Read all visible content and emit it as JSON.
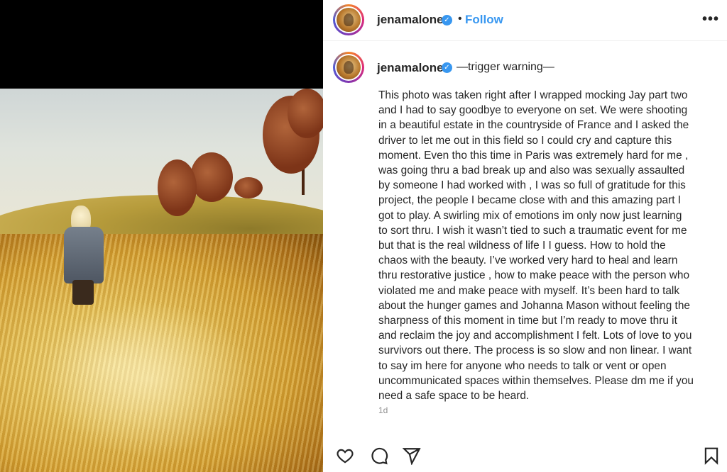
{
  "post": {
    "username": "jenamalone",
    "verified_icon": "verified-badge-icon",
    "separator": "•",
    "follow_label": "Follow",
    "more_label": "•••"
  },
  "caption": {
    "username": "jenamalone",
    "title": "—trigger warning—",
    "body": "This photo was taken right after I wrapped mocking Jay part two\nand I had to say goodbye to everyone on set. We were shooting\nin a beautiful estate in the countryside of France and I asked the\ndriver to let me out in this field so I could cry and capture this\nmoment. Even tho this time in Paris was extremely hard for me ,\nwas going thru a bad break up and also was sexually assaulted\nby someone I had worked with , I was so full of gratitude for this\nproject, the people I became close with and this amazing part I\ngot to play. A swirling mix of emotions im only now just learning\nto sort thru. I wish it wasn’t tied to such a traumatic event for me\nbut that is the real wildness of life I I guess. How to hold the\nchaos with the beauty. I’ve worked very hard to heal and learn\nthru restorative justice , how to make peace with the person who\nviolated me and make peace with myself. It’s been hard to talk\nabout the hunger games and Johanna Mason without feeling the\nsharpness of this moment in time but I’m ready to move thru it\nand reclaim the joy and accomplishment I felt. Lots of love to you\nsurvivors out there. The process is so slow and non linear. I want\nto say im here for anyone who needs to talk or vent or open\nuncommunicated spaces within themselves. Please dm me if you\nneed a safe space to be heard.",
    "timestamp": "1d"
  },
  "actions": {
    "icons": [
      "heart-icon",
      "comment-icon",
      "share-icon",
      "bookmark-icon"
    ]
  },
  "colors": {
    "accent": "#3897f0",
    "text": "#262626",
    "muted": "#8e8e8e"
  }
}
